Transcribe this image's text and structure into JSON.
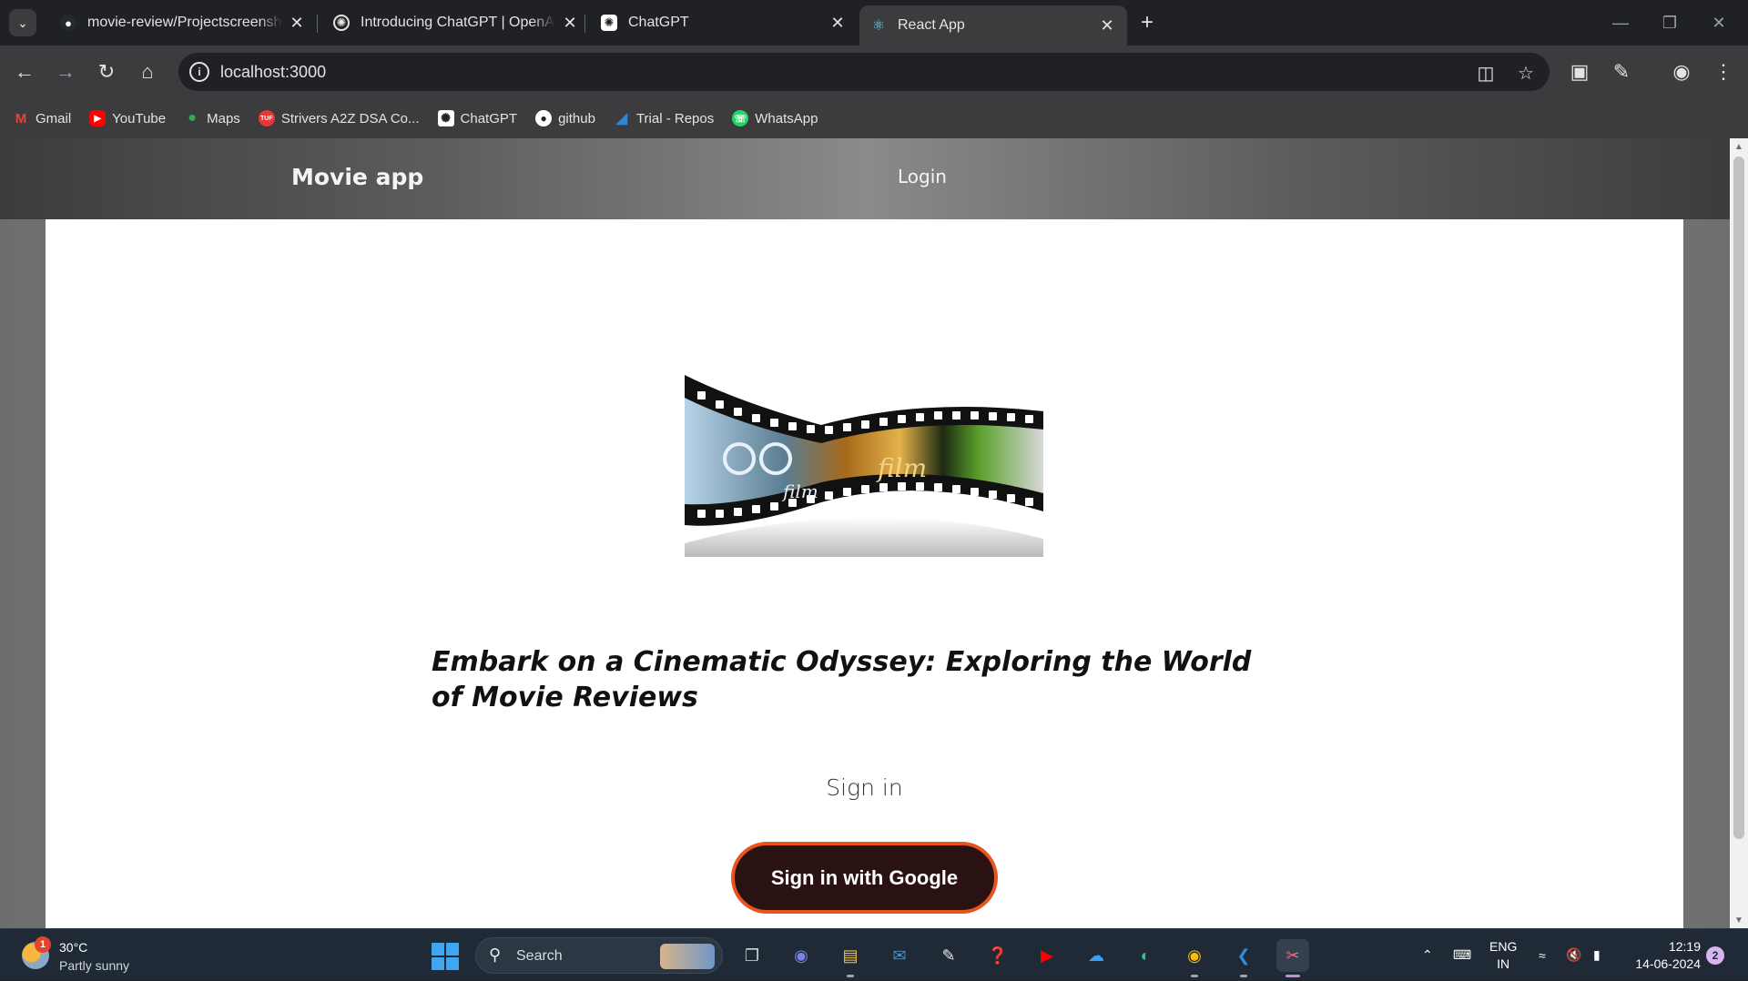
{
  "browser": {
    "tabs": [
      {
        "title": "movie-review/Projectscreenshots",
        "favicon": "github-icon"
      },
      {
        "title": "Introducing ChatGPT | OpenAI",
        "favicon": "openai-icon"
      },
      {
        "title": "ChatGPT",
        "favicon": "openai-icon"
      },
      {
        "title": "React App",
        "favicon": "react-icon",
        "active": true
      }
    ],
    "url": "localhost:3000",
    "bookmarks": [
      {
        "label": "Gmail",
        "icon": "gmail-icon",
        "color": "#ea4335"
      },
      {
        "label": "YouTube",
        "icon": "youtube-icon",
        "color": "#ff0000"
      },
      {
        "label": "Maps",
        "icon": "maps-icon",
        "color": "#34a853"
      },
      {
        "label": "Strivers A2Z DSA Co...",
        "icon": "tuf-icon",
        "color": "#e53935"
      },
      {
        "label": "ChatGPT",
        "icon": "openai-icon",
        "color": "#ffffff"
      },
      {
        "label": "github",
        "icon": "github-icon",
        "color": "#ffffff"
      },
      {
        "label": "Trial - Repos",
        "icon": "azure-devops-icon",
        "color": "#0078d4"
      },
      {
        "label": "WhatsApp",
        "icon": "whatsapp-icon",
        "color": "#25d366"
      }
    ]
  },
  "page": {
    "navbar": {
      "brand": "Movie app",
      "login": "Login"
    },
    "tagline": "Embark on a Cinematic Odyssey: Exploring the World of Movie Reviews",
    "signin_label": "Sign in",
    "google_button": "Sign in with Google",
    "film_text_1": "film",
    "film_text_2": "film",
    "accent_color": "#e8541c"
  },
  "taskbar": {
    "weather_temp": "30°C",
    "weather_desc": "Partly sunny",
    "weather_badge": "1",
    "search_label": "Search",
    "lang_1": "ENG",
    "lang_2": "IN",
    "time": "12:19",
    "date": "14-06-2024",
    "notifications": "2"
  }
}
